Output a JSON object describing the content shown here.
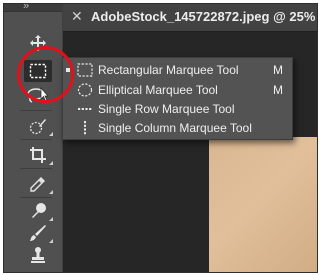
{
  "document_tab": {
    "close_glyph": "✕",
    "title": "AdobeStock_145722872.jpeg @ 25%"
  },
  "toolbar": {
    "collapse_glyph": "»",
    "tools": [
      {
        "name": "move-tool",
        "icon": "move-icon"
      },
      {
        "name": "rectangular-marquee-tool",
        "icon": "rectangular-marquee-icon",
        "active": true
      },
      {
        "name": "lasso-tool",
        "icon": "lasso-icon"
      },
      {
        "name": "quick-selection-tool",
        "icon": "quick-selection-icon"
      },
      {
        "name": "crop-tool",
        "icon": "crop-icon"
      },
      {
        "name": "eyedropper-tool",
        "icon": "eyedropper-icon"
      },
      {
        "name": "healing-brush-tool",
        "icon": "healing-brush-icon"
      },
      {
        "name": "brush-tool",
        "icon": "brush-icon"
      },
      {
        "name": "clone-stamp-tool",
        "icon": "clone-stamp-icon"
      }
    ]
  },
  "flyout": {
    "items": [
      {
        "label": "Rectangular Marquee Tool",
        "shortcut": "M",
        "selected": true,
        "icon": "rectangular-marquee-icon"
      },
      {
        "label": "Elliptical Marquee Tool",
        "shortcut": "M",
        "selected": false,
        "icon": "elliptical-marquee-icon"
      },
      {
        "label": "Single Row Marquee Tool",
        "shortcut": "",
        "selected": false,
        "icon": "single-row-marquee-icon"
      },
      {
        "label": "Single Column Marquee Tool",
        "shortcut": "",
        "selected": false,
        "icon": "single-column-marquee-icon"
      }
    ]
  },
  "colors": {
    "annotation_circle": "#e3101b",
    "toolbar_bg": "#505050",
    "canvas_bg": "#262626",
    "image_tone": "#dcb995"
  }
}
